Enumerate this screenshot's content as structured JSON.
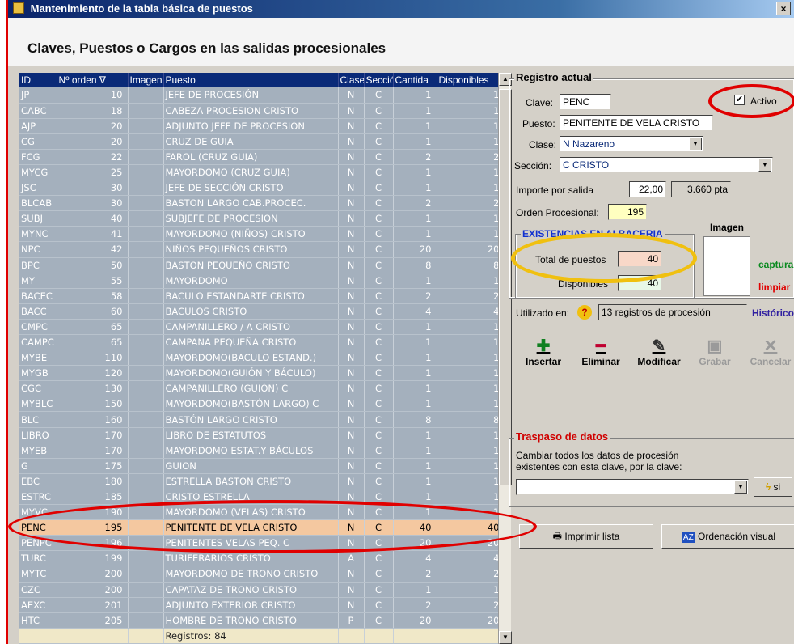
{
  "window": {
    "title": "Mantenimiento de la tabla básica de puestos",
    "close": "×"
  },
  "page": {
    "heading": "Claves, Puestos o Cargos en las salidas procesionales"
  },
  "grid": {
    "columns": [
      "ID",
      "Nº orden ∇",
      "Imagen",
      "Puesto",
      "Clase",
      "Secciór",
      "Cantida",
      "Disponibles"
    ],
    "rows": [
      [
        "JP",
        "10",
        "",
        "JEFE DE PROCESIÓN",
        "N",
        "C",
        "1",
        "1"
      ],
      [
        "CABC",
        "18",
        "",
        "CABEZA PROCESION CRISTO",
        "N",
        "C",
        "1",
        "1"
      ],
      [
        "AJP",
        "20",
        "",
        "ADJUNTO JEFE DE PROCESIÓN",
        "N",
        "C",
        "1",
        "1"
      ],
      [
        "CG",
        "20",
        "",
        "CRUZ DE GUIA",
        "N",
        "C",
        "1",
        "1"
      ],
      [
        "FCG",
        "22",
        "",
        "FAROL (CRUZ GUIA)",
        "N",
        "C",
        "2",
        "2"
      ],
      [
        "MYCG",
        "25",
        "",
        "MAYORDOMO (CRUZ GUIA)",
        "N",
        "C",
        "1",
        "1"
      ],
      [
        "JSC",
        "30",
        "",
        "JEFE DE SECCIÓN CRISTO",
        "N",
        "C",
        "1",
        "1"
      ],
      [
        "BLCAB",
        "30",
        "",
        "BASTON LARGO CAB.PROCEC.",
        "N",
        "C",
        "2",
        "2"
      ],
      [
        "SUBJ",
        "40",
        "",
        "SUBJEFE DE PROCESION",
        "N",
        "C",
        "1",
        "1"
      ],
      [
        "MYNC",
        "41",
        "",
        "MAYORDOMO (NIÑOS) CRISTO",
        "N",
        "C",
        "1",
        "1"
      ],
      [
        "NPC",
        "42",
        "",
        "NIÑOS PEQUEÑOS CRISTO",
        "N",
        "C",
        "20",
        "20"
      ],
      [
        "BPC",
        "50",
        "",
        "BASTON PEQUEÑO CRISTO",
        "N",
        "C",
        "8",
        "8"
      ],
      [
        "MY",
        "55",
        "",
        "MAYORDOMO",
        "N",
        "C",
        "1",
        "1"
      ],
      [
        "BACEC",
        "58",
        "",
        "BACULO ESTANDARTE CRISTO",
        "N",
        "C",
        "2",
        "2"
      ],
      [
        "BACC",
        "60",
        "",
        "BACULOS CRISTO",
        "N",
        "C",
        "4",
        "4"
      ],
      [
        "CMPC",
        "65",
        "",
        "CAMPANILLERO / A CRISTO",
        "N",
        "C",
        "1",
        "1"
      ],
      [
        "CAMPC",
        "65",
        "",
        "CAMPANA PEQUEÑA CRISTO",
        "N",
        "C",
        "1",
        "1"
      ],
      [
        "MYBE",
        "110",
        "",
        "MAYORDOMO(BACULO ESTAND.)",
        "N",
        "C",
        "1",
        "1"
      ],
      [
        "MYGB",
        "120",
        "",
        "MAYORDOMO(GUIÓN Y BÁCULO)",
        "N",
        "C",
        "1",
        "1"
      ],
      [
        "CGC",
        "130",
        "",
        "CAMPANILLERO (GUIÓN) C",
        "N",
        "C",
        "1",
        "1"
      ],
      [
        "MYBLC",
        "150",
        "",
        "MAYORDOMO(BASTÓN LARGO) C",
        "N",
        "C",
        "1",
        "1"
      ],
      [
        "BLC",
        "160",
        "",
        "BASTÓN LARGO CRISTO",
        "N",
        "C",
        "8",
        "8"
      ],
      [
        "LIBRO",
        "170",
        "",
        "LIBRO DE ESTATUTOS",
        "N",
        "C",
        "1",
        "1"
      ],
      [
        "MYEB",
        "170",
        "",
        "MAYORDOMO ESTAT.Y BÁCULOS",
        "N",
        "C",
        "1",
        "1"
      ],
      [
        "G",
        "175",
        "",
        "GUION",
        "N",
        "C",
        "1",
        "1"
      ],
      [
        "EBC",
        "180",
        "",
        "ESTRELLA BASTON CRISTO",
        "N",
        "C",
        "1",
        "1"
      ],
      [
        "ESTRC",
        "185",
        "",
        "CRISTO ESTRELLA",
        "N",
        "C",
        "1",
        "1"
      ],
      [
        "MYVC",
        "190",
        "",
        "MAYORDOMO (VELAS) CRISTO",
        "N",
        "C",
        "1",
        "1"
      ],
      [
        "PENC",
        "195",
        "",
        "PENITENTE DE VELA CRISTO",
        "N",
        "C",
        "40",
        "40"
      ],
      [
        "PENPC",
        "196",
        "",
        "PENITENTES VELAS PEQ. C",
        "N",
        "C",
        "20",
        "20"
      ],
      [
        "TURC",
        "199",
        "",
        "TURIFERARIOS CRISTO",
        "A",
        "C",
        "4",
        "4"
      ],
      [
        "MYTC",
        "200",
        "",
        "MAYORDOMO DE TRONO CRISTO",
        "N",
        "C",
        "2",
        "2"
      ],
      [
        "CZC",
        "200",
        "",
        "CAPATAZ DE TRONO CRISTO",
        "N",
        "C",
        "1",
        "1"
      ],
      [
        "AEXC",
        "201",
        "",
        "ADJUNTO EXTERIOR CRISTO",
        "N",
        "C",
        "2",
        "2"
      ],
      [
        "HTC",
        "205",
        "",
        "HOMBRE DE TRONO CRISTO",
        "P",
        "C",
        "20",
        "20"
      ]
    ],
    "footer": "Registros: 84"
  },
  "registro": {
    "title": "Registro actual",
    "clave_label": "Clave:",
    "clave": "PENC",
    "activo_label": "Activo",
    "puesto_label": "Puesto:",
    "puesto": "PENITENTE DE VELA CRISTO",
    "clase_label": "Clase:",
    "clase_code": "N",
    "clase": "Nazareno",
    "seccion_label": "Sección:",
    "seccion_code": "C",
    "seccion": "CRISTO",
    "importe_label": "Importe por salida",
    "importe": "22,00",
    "importe_pta": "3.660 pta",
    "orden_label": "Orden Procesional:",
    "orden": "195",
    "imagen_label": "Imagen",
    "existencias_title": "EXISTENCIAS EN ALBACERIA",
    "total_label": "Total de puestos",
    "total": "40",
    "disponibles_label": "Disponibles",
    "disponibles": "40",
    "capturar": "capturar",
    "limpiar": "limpiar",
    "utilizado_label": "Utilizado en:",
    "utilizado": "13 registros de procesión",
    "historico": "Histórico"
  },
  "toolbar": {
    "insertar": "Insertar",
    "eliminar": "Eliminar",
    "modificar": "Modificar",
    "grabar": "Grabar",
    "cancelar": "Cancelar"
  },
  "traspaso": {
    "title": "Traspaso de datos",
    "text1": "Cambiar todos los datos de procesión",
    "text2": "existentes con esta clave, por la clave:",
    "si": "si"
  },
  "bottom": {
    "imprimir": "Imprimir lista",
    "ordenacion": "Ordenación visual"
  },
  "colors": {
    "grid_bg": "#a4b0bd",
    "header_bg": "#0a2a78",
    "selected_row": "#f4c8a0",
    "annotation_red": "#e00000",
    "annotation_yellow": "#f0c010"
  }
}
